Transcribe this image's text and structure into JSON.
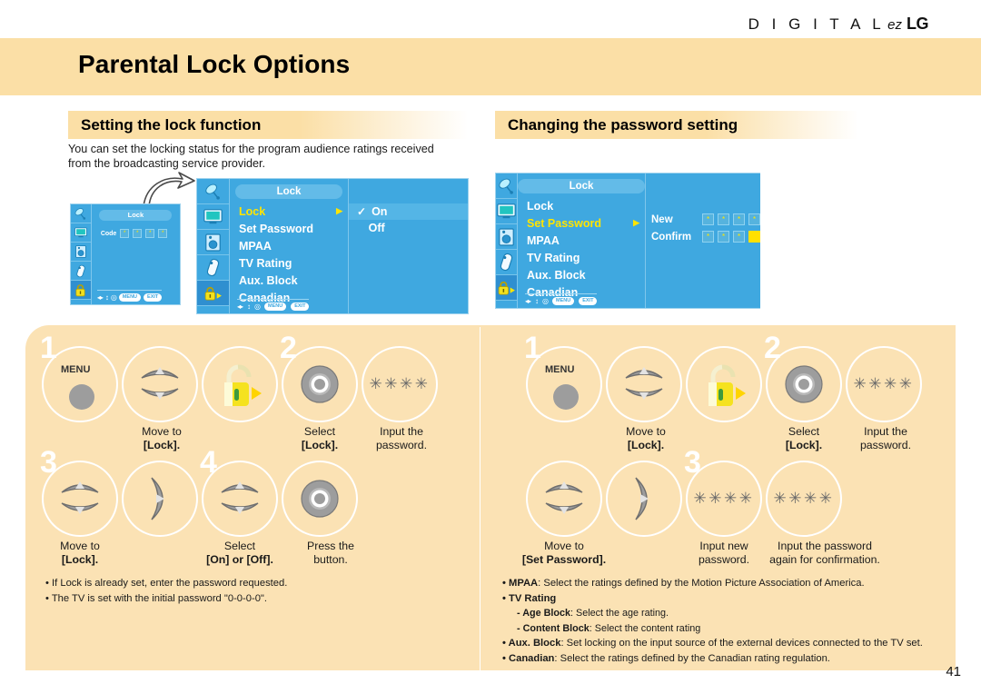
{
  "brand": {
    "digital": "D I G I T A L",
    "ez": "ez",
    "lg": "LG"
  },
  "header": {
    "title": "Parental Lock Options"
  },
  "page_number": "41",
  "colors": {
    "band": "#fbdfa6",
    "panel": "#fbe2b4",
    "osd_blue": "#3fa8e0",
    "osd_highlight": "#ffe500"
  },
  "left_column": {
    "section_title": "Setting the lock function",
    "intro": "You can set the locking status for the program audience ratings received from the broadcasting service provider.",
    "osd_small": {
      "title": "Lock",
      "code_label": "Code",
      "code_boxes": [
        "*",
        "*",
        "*",
        "*"
      ],
      "nav": {
        "lr": "◂▸",
        "ud": "↕",
        "ok": "◎",
        "menu": "MENU",
        "exit": "EXIT"
      }
    },
    "osd_main": {
      "title": "Lock",
      "items": [
        {
          "label": "Lock",
          "selected": true,
          "arrow": "▶"
        },
        {
          "label": "Set Password",
          "selected": false,
          "arrow": ""
        },
        {
          "label": "MPAA",
          "selected": false,
          "arrow": ""
        },
        {
          "label": "TV Rating",
          "selected": false,
          "arrow": ""
        },
        {
          "label": "Aux. Block",
          "selected": false,
          "arrow": ""
        },
        {
          "label": "Canadian",
          "selected": false,
          "arrow": ""
        }
      ],
      "options": [
        {
          "label": "On",
          "checked": true
        },
        {
          "label": "Off",
          "checked": false
        }
      ],
      "nav": {
        "lr": "◂▸",
        "ud": "↕",
        "ok": "◎",
        "menu": "MENU",
        "exit": "EXIT"
      }
    },
    "steps": [
      {
        "num": "1",
        "icon": "menu-button",
        "label": "MENU",
        "caption": ""
      },
      {
        "num": "",
        "icon": "up-down-arrows",
        "caption": "Move to",
        "caption_bold": "[Lock]."
      },
      {
        "num": "",
        "icon": "lock-icon",
        "caption": ""
      },
      {
        "num": "2",
        "icon": "ok-button",
        "caption": "Select",
        "caption_bold": "[Lock]."
      },
      {
        "num": "",
        "icon": "stars",
        "stars": "✳✳✳✳",
        "caption": "Input the",
        "caption_line2": "password."
      },
      {
        "num": "3",
        "icon": "up-down-arrows",
        "caption": "Move to",
        "caption_bold": "[Lock]."
      },
      {
        "num": "",
        "icon": "right-arrow",
        "caption": ""
      },
      {
        "num": "4",
        "icon": "up-down-arrows",
        "caption": "Select",
        "caption_bold": "[On] or [Off]."
      },
      {
        "num": "",
        "icon": "ok-button",
        "caption": "Press the",
        "caption_line2": "button."
      }
    ],
    "notes": [
      "• If Lock is already set, enter the password requested.",
      "• The TV is set with the initial password \"0-0-0-0\"."
    ]
  },
  "right_column": {
    "section_title": "Changing the password setting",
    "osd_main": {
      "title": "Lock",
      "items": [
        {
          "label": "Lock",
          "selected": false,
          "arrow": ""
        },
        {
          "label": "Set Password",
          "selected": true,
          "arrow": "▶"
        },
        {
          "label": "MPAA",
          "selected": false,
          "arrow": ""
        },
        {
          "label": "TV Rating",
          "selected": false,
          "arrow": ""
        },
        {
          "label": "Aux. Block",
          "selected": false,
          "arrow": ""
        },
        {
          "label": "Canadian",
          "selected": false,
          "arrow": ""
        }
      ],
      "password_rows": [
        {
          "label": "New",
          "boxes": [
            "*",
            "*",
            "*",
            "*"
          ],
          "cursor_index": -1
        },
        {
          "label": "Confirm",
          "boxes": [
            "*",
            "*",
            "*",
            ""
          ],
          "cursor_index": 3
        }
      ],
      "nav": {
        "lr": "◂▸",
        "ud": "↕",
        "ok": "◎",
        "menu": "MENU",
        "exit": "EXIT"
      }
    },
    "steps": [
      {
        "num": "1",
        "icon": "menu-button",
        "label": "MENU",
        "caption": ""
      },
      {
        "num": "",
        "icon": "up-down-arrows",
        "caption": "Move to",
        "caption_bold": "[Lock]."
      },
      {
        "num": "",
        "icon": "lock-icon",
        "caption": ""
      },
      {
        "num": "2",
        "icon": "ok-button",
        "caption": "Select",
        "caption_bold": "[Lock]."
      },
      {
        "num": "",
        "icon": "stars",
        "stars": "✳✳✳✳",
        "caption": "Input the",
        "caption_line2": "password."
      },
      {
        "num": "",
        "icon": "up-down-arrows",
        "caption": "Move to",
        "caption_bold": "[Set Password]."
      },
      {
        "num": "",
        "icon": "right-arrow",
        "caption": ""
      },
      {
        "num": "3",
        "icon": "stars",
        "stars": "✳✳✳✳",
        "caption": "Input new",
        "caption_line2": "password."
      },
      {
        "num": "",
        "icon": "stars",
        "stars": "✳✳✳✳",
        "caption": "Input the password",
        "caption_line2": "again for confirmation."
      }
    ],
    "notes": [
      {
        "bold": "• MPAA",
        "rest": ": Select the ratings defined by the Motion Picture Association of America."
      },
      {
        "bold": "• TV Rating",
        "rest": ""
      },
      {
        "bold": "   - Age Block",
        "rest": ": Select the age rating.",
        "sub": true
      },
      {
        "bold": "   - Content Block",
        "rest": ": Select the content rating",
        "sub": true
      },
      {
        "bold": "• Aux. Block",
        "rest": ": Set locking on the input source of the external devices connected to the TV set."
      },
      {
        "bold": "• Canadian",
        "rest": ": Select the ratings defined by the Canadian rating regulation."
      }
    ]
  }
}
